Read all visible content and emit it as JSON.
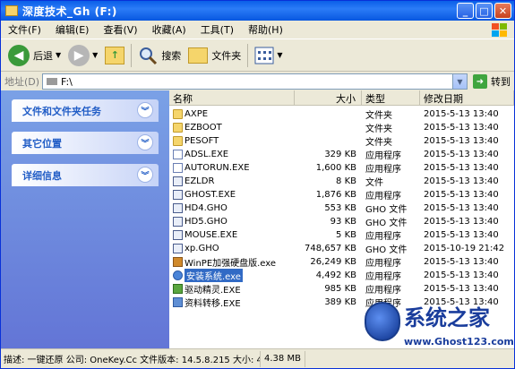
{
  "window": {
    "title": "深度技术_Gh (F:)"
  },
  "menu": [
    "文件(F)",
    "编辑(E)",
    "查看(V)",
    "收藏(A)",
    "工具(T)",
    "帮助(H)"
  ],
  "toolbar": {
    "back": "后退",
    "search": "搜索",
    "folders": "文件夹"
  },
  "address": {
    "label": "地址(D)",
    "value": "F:\\",
    "go": "转到"
  },
  "left_panels": [
    "文件和文件夹任务",
    "其它位置",
    "详细信息"
  ],
  "columns": [
    "名称",
    "大小",
    "类型",
    "修改日期"
  ],
  "files": [
    {
      "name": "AXPE",
      "size": "",
      "type": "文件夹",
      "date": "2015-5-13 13:40",
      "icon": "folder"
    },
    {
      "name": "EZBOOT",
      "size": "",
      "type": "文件夹",
      "date": "2015-5-13 13:40",
      "icon": "folder"
    },
    {
      "name": "PESOFT",
      "size": "",
      "type": "文件夹",
      "date": "2015-5-13 13:40",
      "icon": "folder"
    },
    {
      "name": "ADSL.EXE",
      "size": "329 KB",
      "type": "应用程序",
      "date": "2015-5-13 13:40",
      "icon": "exe"
    },
    {
      "name": "AUTORUN.EXE",
      "size": "1,600 KB",
      "type": "应用程序",
      "date": "2015-5-13 13:40",
      "icon": "exe"
    },
    {
      "name": "EZLDR",
      "size": "8 KB",
      "type": "文件",
      "date": "2015-5-13 13:40",
      "icon": "gho"
    },
    {
      "name": "GHOST.EXE",
      "size": "1,876 KB",
      "type": "应用程序",
      "date": "2015-5-13 13:40",
      "icon": "gho"
    },
    {
      "name": "HD4.GHO",
      "size": "553 KB",
      "type": "GHO 文件",
      "date": "2015-5-13 13:40",
      "icon": "gho"
    },
    {
      "name": "HD5.GHO",
      "size": "93 KB",
      "type": "GHO 文件",
      "date": "2015-5-13 13:40",
      "icon": "gho"
    },
    {
      "name": "MOUSE.EXE",
      "size": "5 KB",
      "type": "应用程序",
      "date": "2015-5-13 13:40",
      "icon": "gho"
    },
    {
      "name": "xp.GHO",
      "size": "748,657 KB",
      "type": "GHO 文件",
      "date": "2015-10-19 21:42",
      "icon": "gho"
    },
    {
      "name": "WinPE加强硬盘版.exe",
      "size": "26,249 KB",
      "type": "应用程序",
      "date": "2015-5-13 13:40",
      "icon": "pe"
    },
    {
      "name": "安装系统.exe",
      "size": "4,492 KB",
      "type": "应用程序",
      "date": "2015-5-13 13:40",
      "icon": "disc",
      "selected": true
    },
    {
      "name": "驱动精灵.EXE",
      "size": "985 KB",
      "type": "应用程序",
      "date": "2015-5-13 13:40",
      "icon": "drv"
    },
    {
      "name": "资料转移.EXE",
      "size": "389 KB",
      "type": "应用程序",
      "date": "2015-5-13 13:40",
      "icon": "cp"
    }
  ],
  "status": {
    "desc": "描述: 一键还原 公司: OneKey.Cc 文件版本: 14.5.8.215 大小: 4.38 MB",
    "size": "4.38 MB"
  },
  "watermark": {
    "text": "系统之家",
    "url": "www.Ghost123.com"
  }
}
